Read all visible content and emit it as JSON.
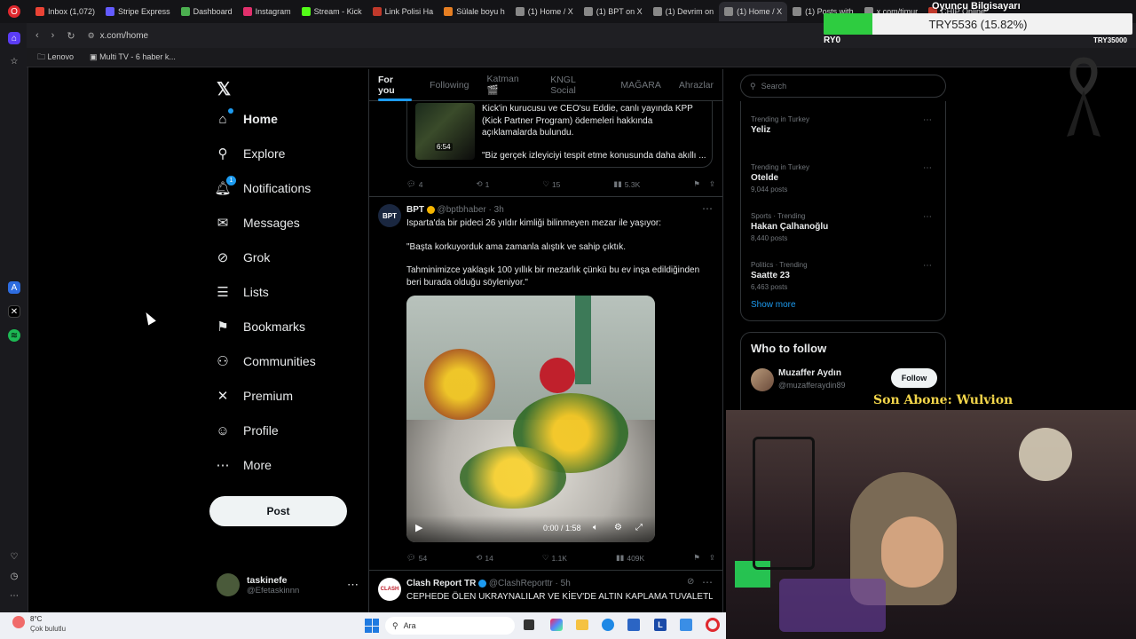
{
  "browser": {
    "tabs": [
      {
        "label": "Inbox (1,072)",
        "color": "#ea4335"
      },
      {
        "label": "Stripe Express",
        "color": "#635bff"
      },
      {
        "label": "Dashboard",
        "color": "#4caf50"
      },
      {
        "label": "Instagram",
        "color": "#e1306c"
      },
      {
        "label": "Stream - Kick",
        "color": "#53fc18"
      },
      {
        "label": "Link Polisi Ha",
        "color": "#c0392b"
      },
      {
        "label": "Sülale boyu h",
        "color": "#e67e22"
      },
      {
        "label": "(1) Home / X",
        "color": "#888"
      },
      {
        "label": "(1) BPT on X",
        "color": "#888"
      },
      {
        "label": "(1) Devrim on",
        "color": "#888"
      },
      {
        "label": "(1) Home / X",
        "color": "#888",
        "active": true
      },
      {
        "label": "(1) Posts with",
        "color": "#888"
      },
      {
        "label": "x.com/timur",
        "color": "#888"
      },
      {
        "label": "CHIP Online",
        "color": "#c0392b"
      }
    ],
    "url": "x.com/home",
    "bookmarks": [
      "Lenovo",
      "Multi TV - 6 haber k..."
    ]
  },
  "overlay": {
    "title": "Oyuncu Bilgisayarı",
    "goal_text": "TRY5536 (15.82%)",
    "goal_progress": 0.1582,
    "left_tag": "RY0",
    "right_tag": "TRY35000",
    "subscriber": "Son Abone: Wulvion"
  },
  "nav": {
    "items": [
      {
        "label": "Home",
        "icon": "home-icon",
        "glyph": "⌂"
      },
      {
        "label": "Explore",
        "icon": "search-icon",
        "glyph": "⚲"
      },
      {
        "label": "Notifications",
        "icon": "bell-icon",
        "glyph": "🔔︎",
        "badge": "1"
      },
      {
        "label": "Messages",
        "icon": "mail-icon",
        "glyph": "✉"
      },
      {
        "label": "Grok",
        "icon": "grok-icon",
        "glyph": "⊘"
      },
      {
        "label": "Lists",
        "icon": "list-icon",
        "glyph": "☰"
      },
      {
        "label": "Bookmarks",
        "icon": "bookmark-icon",
        "glyph": "⚑"
      },
      {
        "label": "Communities",
        "icon": "communities-icon",
        "glyph": "⚇"
      },
      {
        "label": "Premium",
        "icon": "x-icon",
        "glyph": "✕"
      },
      {
        "label": "Profile",
        "icon": "profile-icon",
        "glyph": "☺"
      },
      {
        "label": "More",
        "icon": "more-icon",
        "glyph": "⋯"
      }
    ],
    "post_label": "Post",
    "account": {
      "name": "taskinefe",
      "handle": "@Efetaskinnn"
    }
  },
  "feed": {
    "tabs": [
      "For you",
      "Following",
      "Katman 🎬",
      "KNGL Social",
      "MAĞARA",
      "Ahrazlar"
    ],
    "quoted": {
      "text": "Kick'in kurucusu ve CEO'su Eddie, canlı yayında KPP (Kick Partner Program) ödemeleri hakkında açıklamalarda bulundu.",
      "quote": "\"Biz gerçek izleyiciyi tespit etme konusunda daha akıllı ...",
      "duration": "6:54"
    },
    "tweet1_actions": {
      "replies": "4",
      "retweets": "1",
      "likes": "15",
      "views": "5.3K"
    },
    "tweet2": {
      "name": "BPT",
      "handle": "@bptbhaber",
      "time": "· 3h",
      "line1": "Isparta'da bir pideci 26 yıldır kimliği bilinmeyen mezar ile yaşıyor:",
      "line2": "\"Başta korkuyorduk ama zamanla alıştık ve sahip çıktık.",
      "line3": "Tahminimizce yaklaşık 100 yıllık bir mezarlık çünkü bu ev inşa edildiğinden beri burada olduğu söyleniyor.\"",
      "video_time": "0:00 / 1:58",
      "actions": {
        "replies": "54",
        "retweets": "14",
        "likes": "1.1K",
        "views": "409K"
      }
    },
    "tweet3": {
      "name": "Clash Report TR",
      "handle": "@ClashReporttr",
      "time": "· 5h",
      "text": "CEPHEDE ÖLEN UKRAYNALILAR VE KİEV'DE ALTIN KAPLAMA TUVALETLER"
    }
  },
  "sidebar": {
    "search_placeholder": "Search",
    "trends": [
      {
        "context": "Trending in Turkey",
        "name": "Yeliz",
        "count": ""
      },
      {
        "context": "Trending in Turkey",
        "name": "Otelde",
        "count": "9,044 posts"
      },
      {
        "context": "Sports · Trending",
        "name": "Hakan Çalhanoğlu",
        "count": "8,440 posts"
      },
      {
        "context": "Politics · Trending",
        "name": "Saatte 23",
        "count": "6,463 posts"
      }
    ],
    "show_more": "Show more",
    "who_to_follow": "Who to follow",
    "suggestion": {
      "name": "Muzaffer Aydın",
      "handle": "@muzafferaydin89",
      "button": "Follow"
    }
  },
  "taskbar": {
    "temp": "8°C",
    "weather": "Çok bulutlu",
    "search": "Ara"
  }
}
